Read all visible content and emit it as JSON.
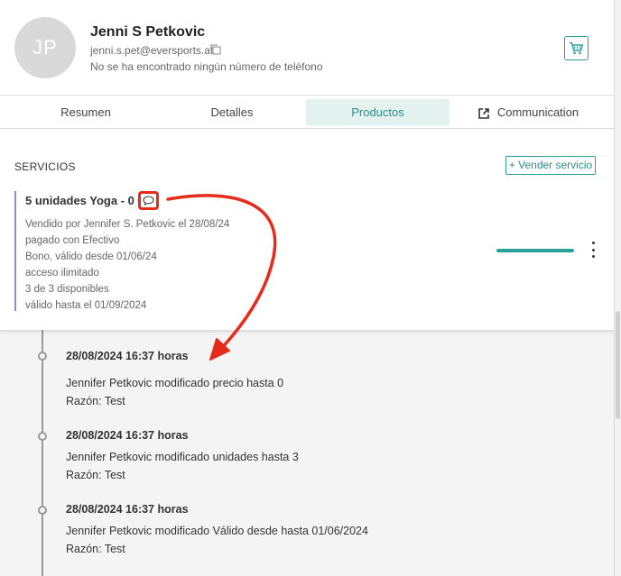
{
  "header": {
    "avatar_initials": "JP",
    "name": "Jenni S Petkovic",
    "email": "jenni.s.pet@eversports.at",
    "phone": "No se ha encontrado ningún número de teléfono"
  },
  "tabs": [
    {
      "label": "Resumen"
    },
    {
      "label": "Detalles"
    },
    {
      "label": "Productos"
    },
    {
      "label": "Communication"
    }
  ],
  "services": {
    "title": "SERVICIOS",
    "sell_button": "+ Vender servicio",
    "item": {
      "title": "5 unidades Yoga - 0 €",
      "lines": [
        "Vendido por Jennifer S. Petkovic el 28/08/24",
        "pagado con Efectivo",
        "Bono, válido desde 01/06/24",
        "acceso ilimitado",
        "3 de 3 disponibles",
        "válido hasta el 01/09/2024"
      ],
      "remaining_fraction": 1.0
    }
  },
  "timeline": [
    {
      "date": "28/08/2024 16:37 horas",
      "text": "Jennifer Petkovic modificado precio hasta 0",
      "reason": "Razón: Test"
    },
    {
      "date": "28/08/2024 16:37 horas",
      "text": "Jennifer Petkovic modificado unidades hasta 3",
      "reason": "Razón: Test"
    },
    {
      "date": "28/08/2024 16:37 horas",
      "text": "Jennifer Petkovic modificado Válido desde hasta 01/06/2024",
      "reason": "Razón: Test"
    }
  ],
  "colors": {
    "accent": "#2aa198",
    "annotation": "#e52b1a",
    "service_border": "#9a8bd0"
  },
  "icons": {
    "copy": "copy-icon",
    "cart": "cart-icon",
    "external": "external-link-icon",
    "comment": "comment-icon",
    "more": "kebab-menu-icon"
  }
}
